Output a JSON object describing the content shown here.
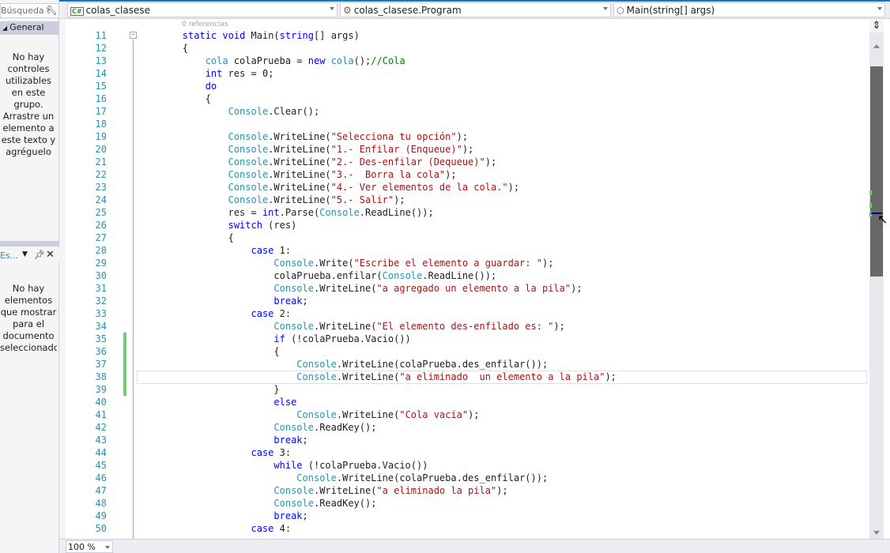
{
  "toolbox": {
    "search_placeholder": "Búsqueda e",
    "search_icon": "wrench-icon",
    "group_label": "General",
    "empty_message": "No hay controles utilizables en este grupo. Arrastre un elemento a este texto y agréguelo"
  },
  "document_outline": {
    "title": "Es...",
    "empty_message": "No hay elementos que mostrar para el documento seleccionado"
  },
  "navbar": {
    "project": "colas_clasese",
    "class": "colas_clasese.Program",
    "member": "Main(string[] args)"
  },
  "editor": {
    "codelens": "0 referencias",
    "lines": [
      {
        "n": "11",
        "tokens": [
          [
            "",
            "        "
          ],
          [
            "k",
            "static"
          ],
          [
            "",
            " "
          ],
          [
            "k",
            "void"
          ],
          [
            "",
            " Main("
          ],
          [
            "k",
            "string"
          ],
          [
            "",
            "[] args)"
          ]
        ]
      },
      {
        "n": "12",
        "tokens": [
          [
            "",
            "        {"
          ]
        ]
      },
      {
        "n": "13",
        "tokens": [
          [
            "",
            "            "
          ],
          [
            "t",
            "cola"
          ],
          [
            "",
            " colaPrueba = "
          ],
          [
            "k",
            "new"
          ],
          [
            "",
            " "
          ],
          [
            "t",
            "cola"
          ],
          [
            "",
            "();"
          ],
          [
            "c",
            "//Cola"
          ]
        ]
      },
      {
        "n": "14",
        "tokens": [
          [
            "",
            "            "
          ],
          [
            "k",
            "int"
          ],
          [
            "",
            " res = 0;"
          ]
        ]
      },
      {
        "n": "15",
        "tokens": [
          [
            "",
            "            "
          ],
          [
            "k",
            "do"
          ]
        ]
      },
      {
        "n": "16",
        "tokens": [
          [
            "",
            "            {"
          ]
        ]
      },
      {
        "n": "17",
        "tokens": [
          [
            "",
            "                "
          ],
          [
            "t",
            "Console"
          ],
          [
            "",
            ".Clear();"
          ]
        ]
      },
      {
        "n": "18",
        "tokens": [
          [
            "",
            ""
          ]
        ]
      },
      {
        "n": "19",
        "tokens": [
          [
            "",
            "                "
          ],
          [
            "t",
            "Console"
          ],
          [
            "",
            ".WriteLine("
          ],
          [
            "s",
            "\"Selecciona tu opción\""
          ],
          [
            "",
            ");"
          ]
        ]
      },
      {
        "n": "20",
        "tokens": [
          [
            "",
            "                "
          ],
          [
            "t",
            "Console"
          ],
          [
            "",
            ".WriteLine("
          ],
          [
            "s",
            "\"1.- Enfilar (Enqueue)\""
          ],
          [
            "",
            ");"
          ]
        ]
      },
      {
        "n": "21",
        "tokens": [
          [
            "",
            "                "
          ],
          [
            "t",
            "Console"
          ],
          [
            "",
            ".WriteLine("
          ],
          [
            "s",
            "\"2.- Des-enfilar (Dequeue)\""
          ],
          [
            "",
            ");"
          ]
        ]
      },
      {
        "n": "22",
        "tokens": [
          [
            "",
            "                "
          ],
          [
            "t",
            "Console"
          ],
          [
            "",
            ".WriteLine("
          ],
          [
            "s",
            "\"3.-  Borra la cola\""
          ],
          [
            "",
            ");"
          ]
        ]
      },
      {
        "n": "23",
        "tokens": [
          [
            "",
            "                "
          ],
          [
            "t",
            "Console"
          ],
          [
            "",
            ".WriteLine("
          ],
          [
            "s",
            "\"4.- Ver elementos de la cola.\""
          ],
          [
            "",
            ");"
          ]
        ]
      },
      {
        "n": "24",
        "tokens": [
          [
            "",
            "                "
          ],
          [
            "t",
            "Console"
          ],
          [
            "",
            ".WriteLine("
          ],
          [
            "s",
            "\"5.- Salir\""
          ],
          [
            "",
            ");"
          ]
        ]
      },
      {
        "n": "25",
        "tokens": [
          [
            "",
            "                res = "
          ],
          [
            "k",
            "int"
          ],
          [
            "",
            ".Parse("
          ],
          [
            "t",
            "Console"
          ],
          [
            "",
            ".ReadLine());"
          ]
        ]
      },
      {
        "n": "26",
        "tokens": [
          [
            "",
            "                "
          ],
          [
            "k",
            "switch"
          ],
          [
            "",
            " (res)"
          ]
        ]
      },
      {
        "n": "27",
        "tokens": [
          [
            "",
            "                {"
          ]
        ]
      },
      {
        "n": "28",
        "tokens": [
          [
            "",
            "                    "
          ],
          [
            "k",
            "case"
          ],
          [
            "",
            " 1:"
          ]
        ]
      },
      {
        "n": "29",
        "tokens": [
          [
            "",
            "                        "
          ],
          [
            "t",
            "Console"
          ],
          [
            "",
            ".Write("
          ],
          [
            "s",
            "\"Escribe el elemento a guardar: \""
          ],
          [
            "",
            ");"
          ]
        ]
      },
      {
        "n": "30",
        "tokens": [
          [
            "",
            "                        colaPrueba.enfilar("
          ],
          [
            "t",
            "Console"
          ],
          [
            "",
            ".ReadLine());"
          ]
        ]
      },
      {
        "n": "31",
        "tokens": [
          [
            "",
            "                        "
          ],
          [
            "t",
            "Console"
          ],
          [
            "",
            ".WriteLine("
          ],
          [
            "s",
            "\"a agregado un elemento a la pila\""
          ],
          [
            "",
            ");"
          ]
        ]
      },
      {
        "n": "32",
        "tokens": [
          [
            "",
            "                        "
          ],
          [
            "k",
            "break"
          ],
          [
            "",
            ";"
          ]
        ]
      },
      {
        "n": "33",
        "tokens": [
          [
            "",
            "                    "
          ],
          [
            "k",
            "case"
          ],
          [
            "",
            " 2:"
          ]
        ]
      },
      {
        "n": "34",
        "tokens": [
          [
            "",
            "                        "
          ],
          [
            "t",
            "Console"
          ],
          [
            "",
            ".WriteLine("
          ],
          [
            "s",
            "\"El elemento des-enfilado es: \""
          ],
          [
            "",
            ");"
          ]
        ]
      },
      {
        "n": "35",
        "changed": true,
        "tokens": [
          [
            "",
            "                        "
          ],
          [
            "k",
            "if"
          ],
          [
            "",
            " (!colaPrueba.Vacio())"
          ]
        ]
      },
      {
        "n": "36",
        "changed": true,
        "tokens": [
          [
            "",
            "                        {"
          ]
        ]
      },
      {
        "n": "37",
        "changed": true,
        "tokens": [
          [
            "",
            "                            "
          ],
          [
            "t",
            "Console"
          ],
          [
            "",
            ".WriteLine(colaPrueba.des_enfilar());"
          ]
        ]
      },
      {
        "n": "38",
        "changed": true,
        "tokens": [
          [
            "",
            "                            "
          ],
          [
            "t",
            "Console"
          ],
          [
            "",
            ".WriteLine("
          ],
          [
            "s",
            "\"a eliminado  un elemento a la pila\""
          ],
          [
            "",
            ");"
          ]
        ]
      },
      {
        "n": "39",
        "changed": true,
        "tokens": [
          [
            "",
            "                        }"
          ]
        ]
      },
      {
        "n": "40",
        "tokens": [
          [
            "",
            "                        "
          ],
          [
            "k",
            "else"
          ]
        ]
      },
      {
        "n": "41",
        "tokens": [
          [
            "",
            "                            "
          ],
          [
            "t",
            "Console"
          ],
          [
            "",
            ".WriteLine("
          ],
          [
            "s",
            "\"Cola vacía\""
          ],
          [
            "",
            ");"
          ]
        ]
      },
      {
        "n": "42",
        "tokens": [
          [
            "",
            "                        "
          ],
          [
            "t",
            "Console"
          ],
          [
            "",
            ".ReadKey();"
          ]
        ]
      },
      {
        "n": "43",
        "tokens": [
          [
            "",
            "                        "
          ],
          [
            "k",
            "break"
          ],
          [
            "",
            ";"
          ]
        ]
      },
      {
        "n": "44",
        "tokens": [
          [
            "",
            "                    "
          ],
          [
            "k",
            "case"
          ],
          [
            "",
            " 3:"
          ]
        ]
      },
      {
        "n": "45",
        "tokens": [
          [
            "",
            "                        "
          ],
          [
            "k",
            "while"
          ],
          [
            "",
            " (!colaPrueba.Vacio())"
          ]
        ]
      },
      {
        "n": "46",
        "tokens": [
          [
            "",
            "                            "
          ],
          [
            "t",
            "Console"
          ],
          [
            "",
            ".WriteLine(colaPrueba.des_enfilar());"
          ]
        ]
      },
      {
        "n": "47",
        "tokens": [
          [
            "",
            "                        "
          ],
          [
            "t",
            "Console"
          ],
          [
            "",
            ".WriteLine("
          ],
          [
            "s",
            "\"a eliminado la pila\""
          ],
          [
            "",
            ");"
          ]
        ]
      },
      {
        "n": "48",
        "tokens": [
          [
            "",
            "                        "
          ],
          [
            "t",
            "Console"
          ],
          [
            "",
            ".ReadKey();"
          ]
        ]
      },
      {
        "n": "49",
        "tokens": [
          [
            "",
            "                        "
          ],
          [
            "k",
            "break"
          ],
          [
            "",
            ";"
          ]
        ]
      },
      {
        "n": "50",
        "tokens": [
          [
            "",
            "                    "
          ],
          [
            "k",
            "case"
          ],
          [
            "",
            " 4:"
          ]
        ]
      }
    ]
  },
  "statusbar": {
    "zoom": "100 %"
  },
  "colors": {
    "keyword": "#0000ff",
    "type": "#2b91af",
    "string": "#a31515",
    "comment": "#008000",
    "change_marker": "#6ecf6e",
    "accent": "#007acc"
  }
}
